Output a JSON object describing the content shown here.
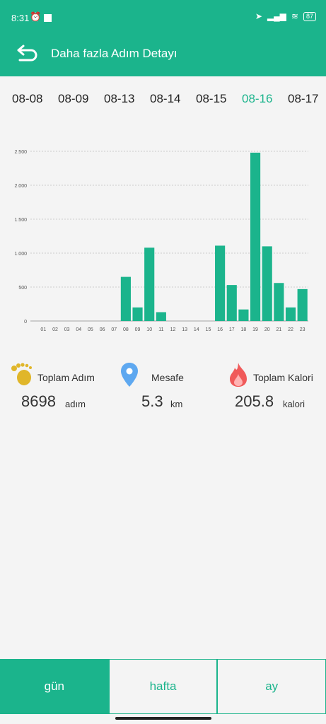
{
  "status": {
    "time": "8:31",
    "battery": "87"
  },
  "header": {
    "title": "Daha fazla Adım Detayı"
  },
  "dates": [
    {
      "label": "08-08",
      "active": false
    },
    {
      "label": "08-09",
      "active": false
    },
    {
      "label": "08-13",
      "active": false
    },
    {
      "label": "08-14",
      "active": false
    },
    {
      "label": "08-15",
      "active": false
    },
    {
      "label": "08-16",
      "active": true
    },
    {
      "label": "08-17",
      "active": false
    }
  ],
  "chart_data": {
    "type": "bar",
    "categories": [
      "01",
      "02",
      "03",
      "04",
      "05",
      "06",
      "07",
      "08",
      "09",
      "10",
      "11",
      "12",
      "13",
      "14",
      "15",
      "16",
      "17",
      "18",
      "19",
      "20",
      "21",
      "22",
      "23"
    ],
    "values": [
      0,
      0,
      0,
      0,
      0,
      0,
      0,
      650,
      200,
      1080,
      130,
      0,
      0,
      0,
      0,
      1110,
      530,
      170,
      2480,
      1100,
      560,
      200,
      470
    ],
    "yticks": [
      "0",
      "500",
      "1.000",
      "1.500",
      "2.000",
      "2.500"
    ],
    "ylim": [
      0,
      2500
    ],
    "color": "#1bb48c",
    "grid": true
  },
  "stats": {
    "steps": {
      "label": "Toplam Adım",
      "value": "8698",
      "unit": "adım"
    },
    "distance": {
      "label": "Mesafe",
      "value": "5.3",
      "unit": "km"
    },
    "calories": {
      "label": "Toplam Kalori",
      "value": "205.8",
      "unit": "kalori"
    }
  },
  "tabs": [
    {
      "label": "gün",
      "active": true
    },
    {
      "label": "hafta",
      "active": false
    },
    {
      "label": "ay",
      "active": false
    }
  ],
  "colors": {
    "accent": "#1bb48c"
  }
}
